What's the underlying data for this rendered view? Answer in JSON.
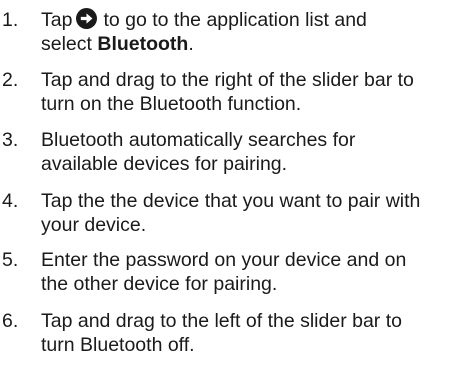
{
  "steps": [
    {
      "number": "1.",
      "line1_before": "Tap",
      "icon": "arrow-right-circle-icon",
      "line1_after": "to go to the application list and",
      "line2_before": "select ",
      "line2_bold": "Bluetooth",
      "line2_after": "."
    },
    {
      "number": "2.",
      "line1": "Tap and drag to the right of the slider bar to",
      "line2": "turn on the Bluetooth function."
    },
    {
      "number": "3.",
      "line1": "Bluetooth automatically searches for",
      "line2": "available devices for pairing."
    },
    {
      "number": "4.",
      "line1": "Tap the the device that you want to pair with",
      "line2": "your device."
    },
    {
      "number": "5.",
      "line1": "Enter the password on your device and on",
      "line2": "the other device for pairing."
    },
    {
      "number": "6.",
      "line1": "Tap and drag to the left of the slider bar to",
      "line2": "turn Bluetooth off."
    }
  ]
}
